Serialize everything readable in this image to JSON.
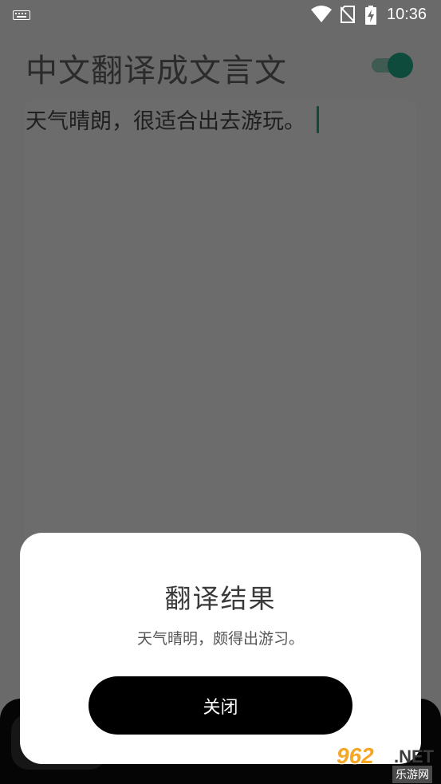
{
  "status_bar": {
    "time": "10:36",
    "icons": [
      "keyboard-icon",
      "wifi-icon",
      "no-sim-icon",
      "battery-charging-icon"
    ]
  },
  "app": {
    "title": "中文翻译成文言文",
    "toggle_on": true,
    "input_text": "天气晴朗，很适合出去游玩。"
  },
  "dialog": {
    "title": "翻译结果",
    "result": "天气晴明，颇得出游习。",
    "close_label": "关闭"
  },
  "watermark": {
    "number": "962",
    "suffix": ".NET",
    "site": "乐游网"
  },
  "colors": {
    "accent": "#0e4b3c",
    "dialog_bg": "#ffffff",
    "button_bg": "#000000"
  }
}
